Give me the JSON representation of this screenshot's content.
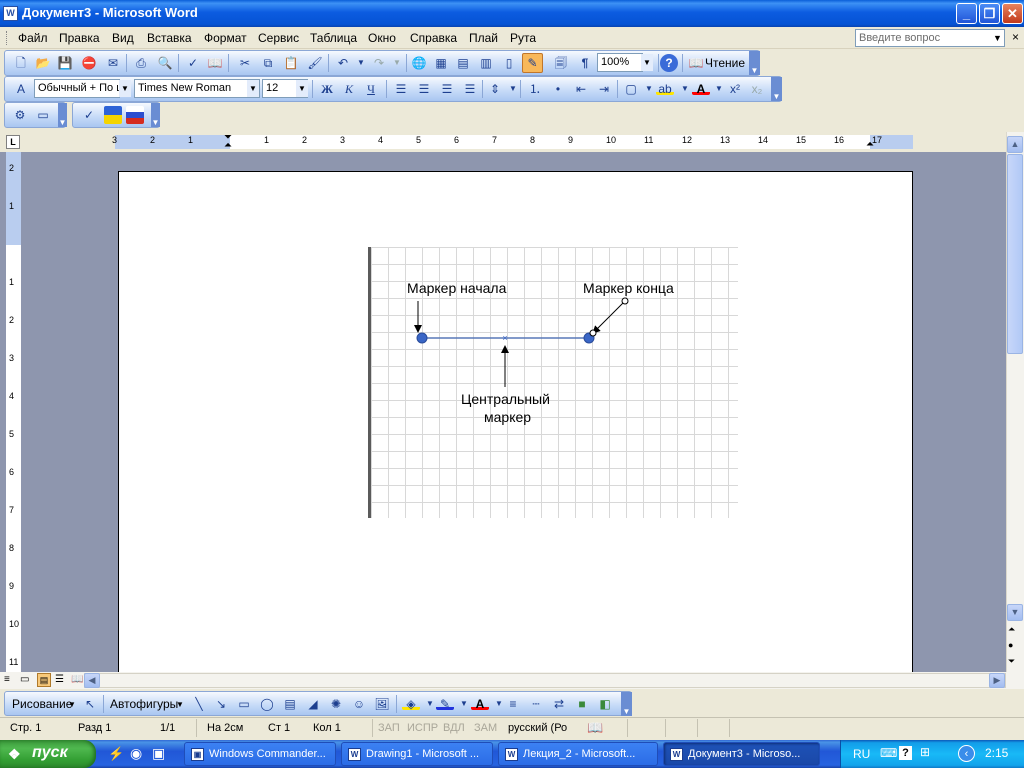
{
  "window": {
    "title": "Документ3 - Microsoft Word",
    "icon": "word-doc-icon"
  },
  "menu": {
    "items": [
      "Файл",
      "Правка",
      "Вид",
      "Вставка",
      "Формат",
      "Сервис",
      "Таблица",
      "Окно",
      "Справка",
      "Плай",
      "Рута"
    ],
    "help_placeholder": "Введите вопрос",
    "close_glyph": "×"
  },
  "standard_toolbar": {
    "zoom": "100%",
    "reading_label": "Чтение"
  },
  "format_toolbar": {
    "style": "Обычный + По ц",
    "font": "Times New Roman",
    "size": "12",
    "bold": "Ж",
    "italic": "К",
    "underline": "Ч"
  },
  "ruler": {
    "corner": "L",
    "h_labels": [
      "3",
      "2",
      "1",
      "",
      "1",
      "2",
      "3",
      "4",
      "5",
      "6",
      "7",
      "8",
      "9",
      "10",
      "11",
      "12",
      "13",
      "14",
      "15",
      "16",
      "17"
    ],
    "v_labels": [
      "2",
      "1",
      "",
      "1",
      "2",
      "3",
      "4",
      "5",
      "6",
      "7",
      "8",
      "9",
      "10",
      "11"
    ]
  },
  "diagram": {
    "label_start": "Маркер  начала",
    "label_end": "Маркер конца",
    "label_center_1": "Центральный",
    "label_center_2": "маркер"
  },
  "drawing_toolbar": {
    "drawing_label": "Рисование",
    "autoshapes_label": "Автофигуры"
  },
  "status": {
    "page": "Стр.  1",
    "section": "Разд  1",
    "pages": "1/1",
    "at": "На  2см",
    "line": "Ст  1",
    "col": "Кол  1",
    "rec": "ЗАП",
    "trk": "ИСПР",
    "ext": "ВДЛ",
    "ovr": "ЗАМ",
    "language": "русский (Ро"
  },
  "taskbar": {
    "start": "пуск",
    "tasks": [
      {
        "label": "Windows Commander...",
        "active": false
      },
      {
        "label": "Drawing1 - Microsoft ...",
        "active": false
      },
      {
        "label": "Лекция_2 - Microsoft...",
        "active": false
      },
      {
        "label": "Документ3 - Microso...",
        "active": true
      }
    ],
    "lang": "RU",
    "clock": "2:15"
  }
}
